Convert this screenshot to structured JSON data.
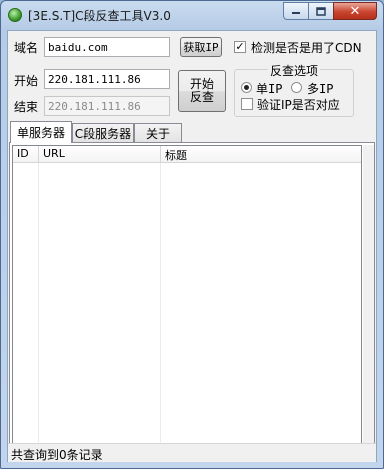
{
  "window": {
    "title": "[3E.S.T]C段反查工具V3.0",
    "close_symbol": "✕"
  },
  "form": {
    "domain_label": "域名",
    "domain_value": "baidu.com",
    "get_ip_button": "获取IP",
    "cdn_check_label": "检测是否是用了CDN",
    "cdn_checked": true,
    "start_label": "开始",
    "start_value": "220.181.111.86",
    "end_label": "结束",
    "end_value": "220.181.111.86",
    "start_reverse_button_line1": "开始",
    "start_reverse_button_line2": "反查"
  },
  "options": {
    "title": "反查选项",
    "single_ip_label": "单IP",
    "multi_ip_label": "多IP",
    "selected": "single",
    "verify_label": "验证IP是否对应",
    "verify_checked": false
  },
  "tabs": [
    {
      "label": "单服务器",
      "active": true
    },
    {
      "label": "C段服务器",
      "active": false
    },
    {
      "label": "关于",
      "active": false
    }
  ],
  "table": {
    "columns": [
      "ID",
      "URL",
      "标题"
    ],
    "rows": []
  },
  "status": {
    "text": "共查询到0条记录"
  },
  "icons": {
    "app": "green-orb-icon",
    "minimize": "minimize-icon",
    "maximize": "maximize-icon",
    "close": "close-icon",
    "check": "checkmark-icon"
  }
}
